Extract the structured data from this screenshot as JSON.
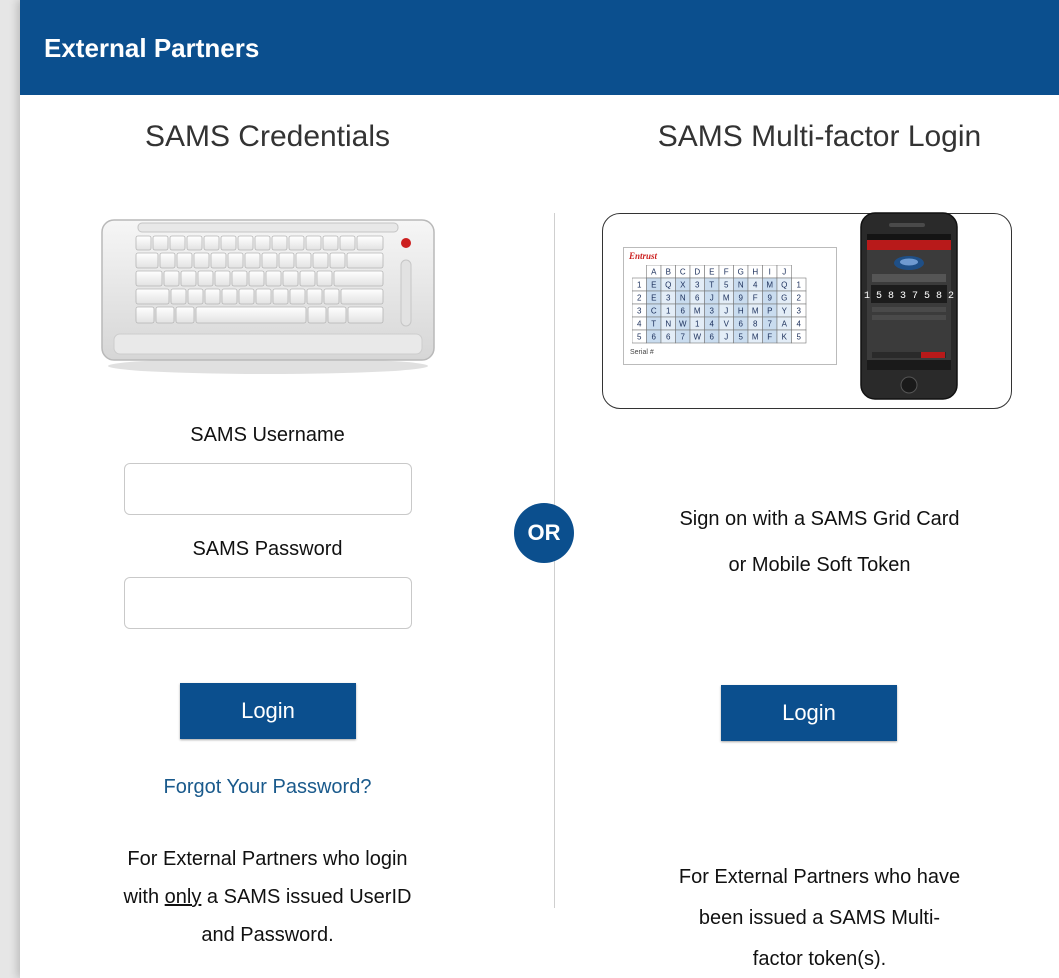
{
  "header": {
    "title": "External Partners"
  },
  "left": {
    "title": "SAMS Credentials",
    "username_label": "SAMS Username",
    "username_value": "",
    "password_label": "SAMS Password",
    "password_value": "",
    "login_label": "Login",
    "forgot_link": "Forgot Your Password?",
    "desc_line1": "For External Partners who login",
    "desc_line2_pre": "with ",
    "desc_line2_underline": "only",
    "desc_line2_post": " a SAMS issued UserID",
    "desc_line3": "and Password."
  },
  "divider": {
    "or_label": "OR"
  },
  "right": {
    "title": "SAMS Multi-factor Login",
    "grid_card": {
      "brand": "Entrust",
      "columns": [
        "A",
        "B",
        "C",
        "D",
        "E",
        "F",
        "G",
        "H",
        "I",
        "J"
      ],
      "rows": [
        [
          "1",
          "E",
          "Q",
          "X",
          "3",
          "T",
          "5",
          "N",
          "4",
          "M",
          "Q",
          "1"
        ],
        [
          "2",
          "E",
          "3",
          "N",
          "6",
          "J",
          "M",
          "9",
          "F",
          "9",
          "G",
          "2"
        ],
        [
          "3",
          "C",
          "1",
          "6",
          "M",
          "3",
          "J",
          "H",
          "M",
          "P",
          "Y",
          "3"
        ],
        [
          "4",
          "T",
          "N",
          "W",
          "1",
          "4",
          "V",
          "6",
          "8",
          "7",
          "A",
          "4"
        ],
        [
          "5",
          "6",
          "6",
          "7",
          "W",
          "6",
          "J",
          "5",
          "M",
          "F",
          "K",
          "5"
        ]
      ],
      "footer": "Serial #"
    },
    "phone": {
      "code": "1 5 8 3 7 5 8 2"
    },
    "desc_top_line1": "Sign on with a SAMS Grid Card",
    "desc_top_line2": "or Mobile Soft Token",
    "login_label": "Login",
    "desc_bottom_line1": "For External Partners who have",
    "desc_bottom_line2": "been issued a SAMS Multi-",
    "desc_bottom_line3": "factor token(s)."
  },
  "colors": {
    "brand": "#0b4f8e",
    "link": "#1a5a8c",
    "entrust_red": "#cc1f1f"
  }
}
